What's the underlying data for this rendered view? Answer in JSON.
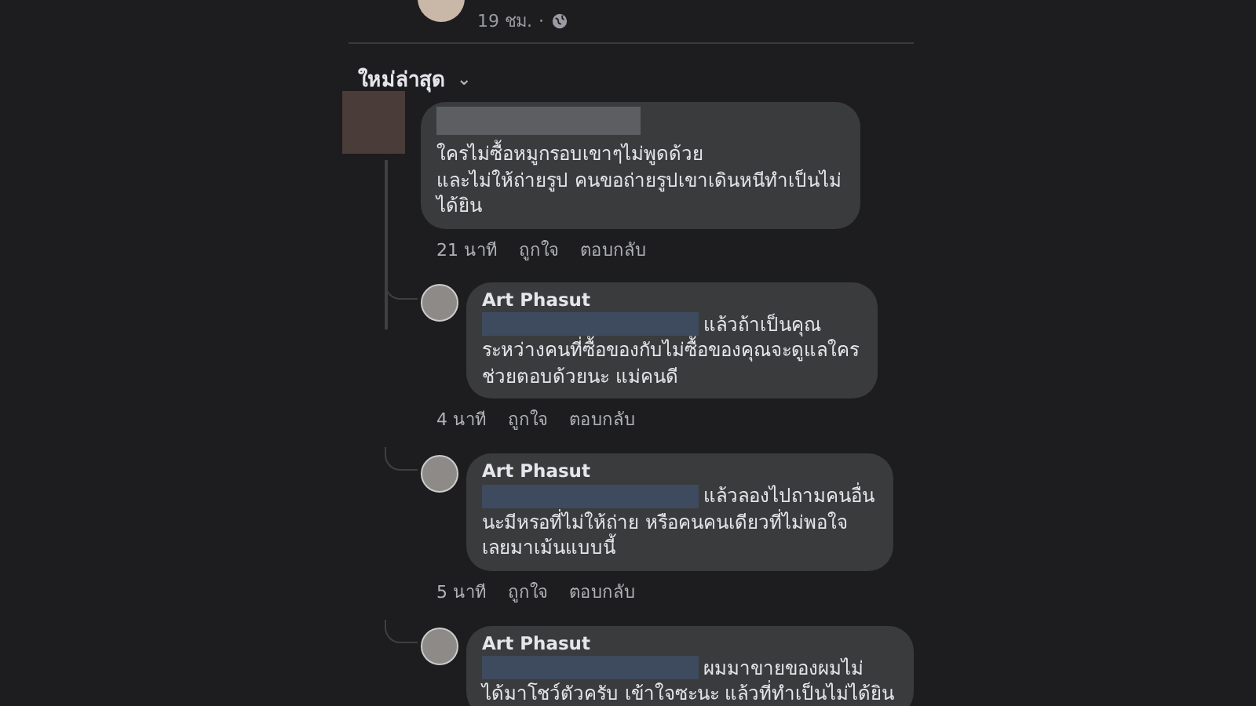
{
  "post_header": {
    "time": "19 ชม.",
    "separator": "·"
  },
  "sort": {
    "label": "ใหม่ล่าสุด",
    "caret": "⌄"
  },
  "comments": [
    {
      "kind": "top",
      "text": "ใครไม่ซื้อหมูกรอบเขาๆไม่พูดด้วย\nและไม่ให้ถ่ายรูป คนขอถ่ายรูปเขาเดินหนีทำเป็นไม่\nได้ยิน",
      "time": "21 นาที",
      "actions": [
        "ถูกใจ",
        "ตอบกลับ"
      ]
    },
    {
      "kind": "reply",
      "author": "Art Phasut",
      "first_line": "แล้วถ้าเป็นคุณ",
      "text": "ระหว่างคนที่ซื้อของกับไม่ซื้อของคุณจะดูแลใคร\nช่วยตอบด้วยนะ แม่คนดี",
      "time": "4 นาที",
      "actions": [
        "ถูกใจ",
        "ตอบกลับ"
      ]
    },
    {
      "kind": "reply",
      "author": "Art Phasut",
      "first_line": "แล้วลองไปถามคนอื่น",
      "text": "นะมีหรอที่ไม่ให้ถ่าย หรือคนคนเดียวที่ไม่พอใจ\nเลยมาเม้นแบบนี้",
      "time": "5 นาที",
      "actions": [
        "ถูกใจ",
        "ตอบกลับ"
      ]
    },
    {
      "kind": "reply",
      "author": "Art Phasut",
      "first_line": "ผมมาขายของผมไม่",
      "text": "ได้มาโชว์ตัวครับ เข้าใจซะนะ แล้วที่ทำเป็นไม่ได้ยิน"
    }
  ]
}
